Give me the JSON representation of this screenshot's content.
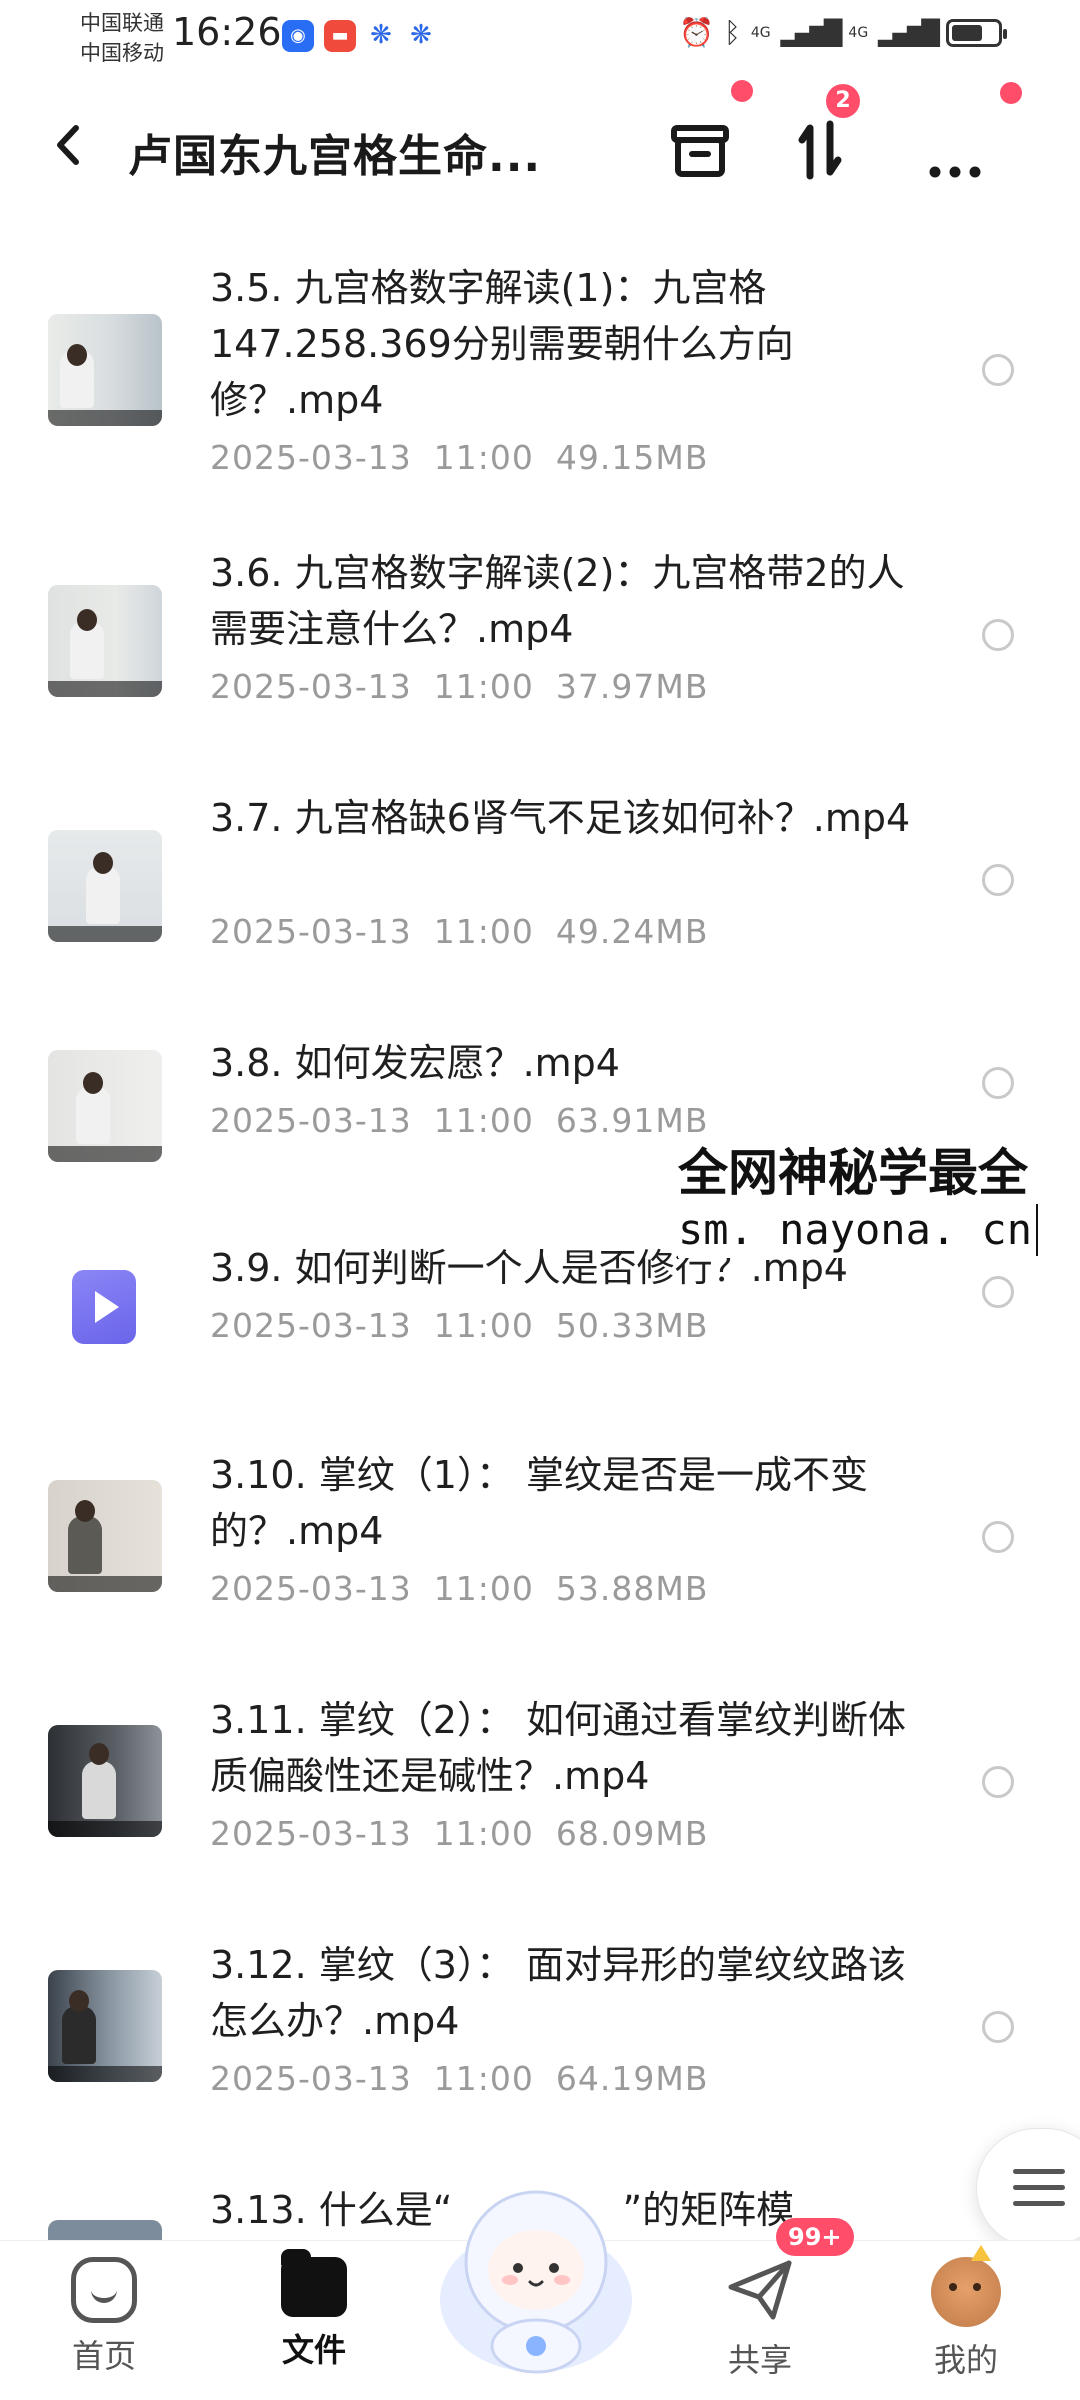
{
  "status_bar": {
    "carrier_1": "中国联通",
    "carrier_2": "中国移动",
    "time": "16:26",
    "network_1": "4G",
    "network_2": "4G"
  },
  "header": {
    "title": "卢国东九宫格生命...",
    "sort_badge": "2",
    "icons": [
      "back-arrow-icon",
      "archive-icon",
      "sort-icon",
      "more-icon"
    ]
  },
  "files": [
    {
      "name": "3.5. 九宫格数字解读(1)：九宫格147.258.369分别需要朝什么方向修？.mp4",
      "date": "2025-03-13",
      "time": "11:00",
      "size": "49.15MB"
    },
    {
      "name": "3.6. 九宫格数字解读(2)：九宫格带2的人需要注意什么？.mp4",
      "date": "2025-03-13",
      "time": "11:00",
      "size": "37.97MB"
    },
    {
      "name": "3.7. 九宫格缺6肾气不足该如何补？.mp4",
      "date": "2025-03-13",
      "time": "11:00",
      "size": "49.24MB"
    },
    {
      "name": "3.8. 如何发宏愿？.mp4",
      "date": "2025-03-13",
      "time": "11:00",
      "size": "63.91MB"
    },
    {
      "name": "3.9. 如何判断一个人是否修行？.mp4",
      "date": "2025-03-13",
      "time": "11:00",
      "size": "50.33MB"
    },
    {
      "name": "3.10. 掌纹（1）： 掌纹是否是一成不变的？.mp4",
      "date": "2025-03-13",
      "time": "11:00",
      "size": "53.88MB"
    },
    {
      "name": "3.11. 掌纹（2）： 如何通过看掌纹判断体质偏酸性还是碱性？.mp4",
      "date": "2025-03-13",
      "time": "11:00",
      "size": "68.09MB"
    },
    {
      "name": "3.12. 掌纹（3）： 面对异形的掌纹纹路该怎么办？.mp4",
      "date": "2025-03-13",
      "time": "11:00",
      "size": "64.19MB"
    },
    {
      "name": "3.13. 什么是“",
      "name_tail": "”的矩阵模"
    }
  ],
  "watermark": {
    "line1": "全网神秘学最全",
    "line2": "sm. nayona. cn"
  },
  "bottom_nav": {
    "home": "首页",
    "files": "文件",
    "share": "共享",
    "me": "我的",
    "share_badge": "99+"
  },
  "colors": {
    "accent_red": "#ff4d6a",
    "meta_gray": "#9a9a9a",
    "video_icon": "#7b76f0"
  }
}
